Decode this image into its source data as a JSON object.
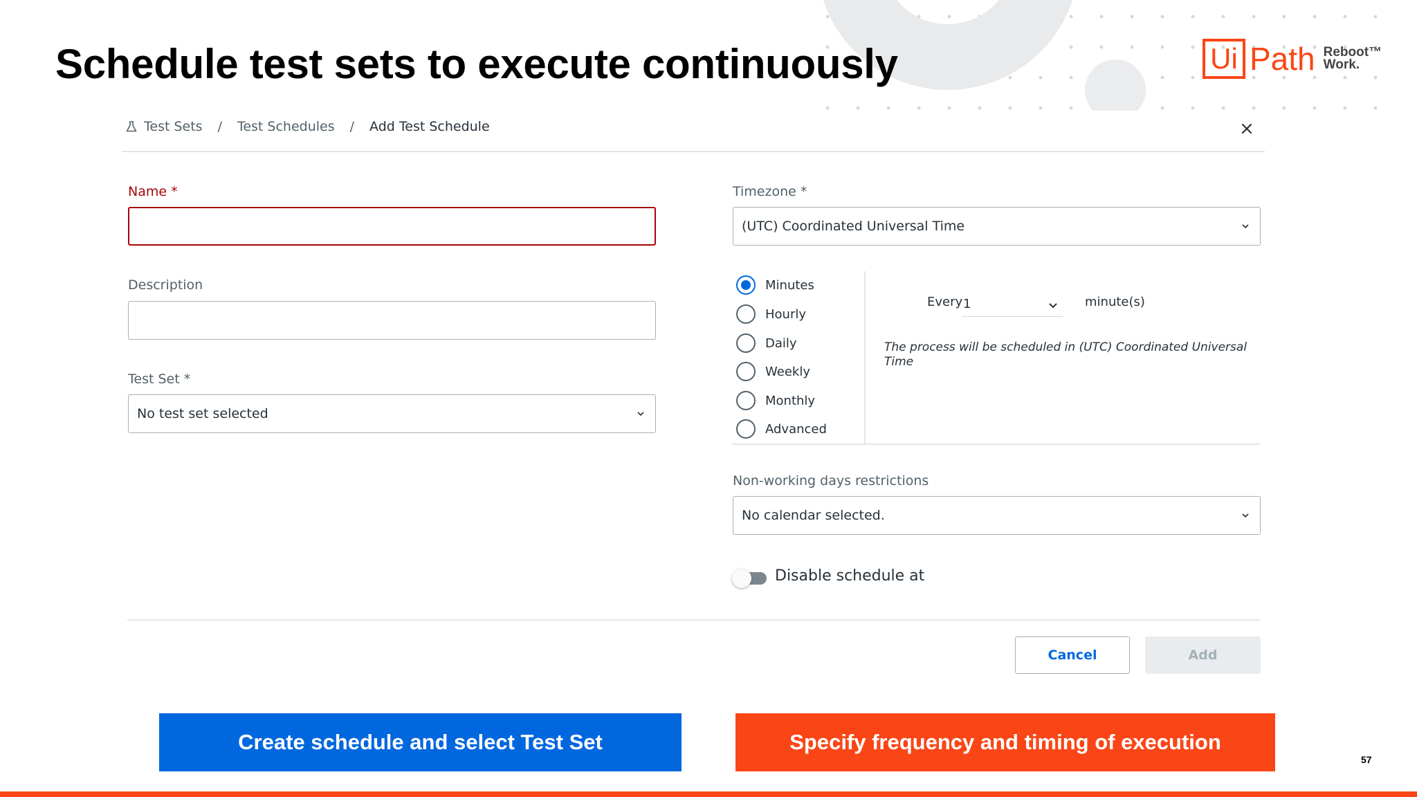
{
  "slide": {
    "title": "Schedule test sets to execute continuously",
    "page_number": "57",
    "logo": {
      "ui": "Ui",
      "path": "Path",
      "reboot": "Reboot™",
      "work": "Work."
    },
    "banners": {
      "left": "Create schedule and select Test Set",
      "right": "Specify frequency and timing of execution"
    },
    "colors": {
      "brand_orange": "#fa4616",
      "brand_blue": "#0067df",
      "error_red": "#a6040a"
    }
  },
  "breadcrumb": {
    "items": [
      "Test Sets",
      "Test Schedules",
      "Add Test Schedule"
    ],
    "separator": "/"
  },
  "form": {
    "name": {
      "label": "Name *",
      "value": ""
    },
    "description": {
      "label": "Description",
      "value": ""
    },
    "test_set": {
      "label": "Test Set *",
      "value": "No test set selected"
    },
    "timezone": {
      "label": "Timezone *",
      "value": "(UTC) Coordinated Universal Time"
    },
    "frequency": {
      "options": [
        "Minutes",
        "Hourly",
        "Daily",
        "Weekly",
        "Monthly",
        "Advanced"
      ],
      "selected": "Minutes",
      "every_label": "Every",
      "every_value": "1",
      "unit": "minute(s)",
      "note": "The process will be scheduled in (UTC) Coordinated Universal Time"
    },
    "non_working": {
      "label": "Non-working days restrictions",
      "value": "No calendar selected."
    },
    "disable_schedule": {
      "label": "Disable schedule at",
      "enabled": false
    }
  },
  "actions": {
    "cancel": "Cancel",
    "add": "Add"
  }
}
